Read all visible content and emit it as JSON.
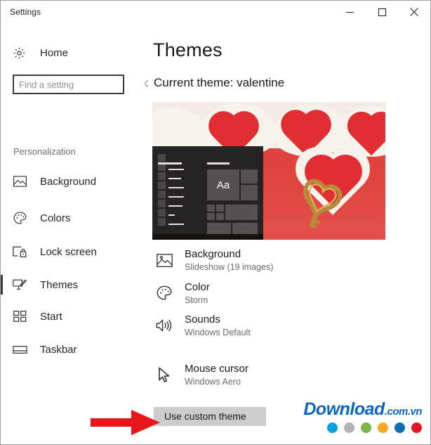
{
  "window": {
    "title": "Settings",
    "controls": [
      {
        "name": "minimize",
        "glyph": "minimize-icon"
      },
      {
        "name": "maximize",
        "glyph": "maximize-icon"
      },
      {
        "name": "close",
        "glyph": "close-icon"
      }
    ]
  },
  "sidebar": {
    "home_label": "Home",
    "home_icon": "gear-icon",
    "search": {
      "placeholder": "Find a setting",
      "value": "",
      "icon": "search-icon"
    },
    "section_label": "Personalization",
    "items": [
      {
        "label": "Background",
        "icon": "image-icon",
        "selected": false
      },
      {
        "label": "Colors",
        "icon": "palette-icon",
        "selected": false
      },
      {
        "label": "Lock screen",
        "icon": "lock-screen-icon",
        "selected": false
      },
      {
        "label": "Themes",
        "icon": "theme-brush-icon",
        "selected": true
      },
      {
        "label": "Start",
        "icon": "start-tiles-icon",
        "selected": false
      },
      {
        "label": "Taskbar",
        "icon": "taskbar-icon",
        "selected": false
      }
    ]
  },
  "main": {
    "page_title": "Themes",
    "current_theme_text": "Current theme: valentine",
    "preview": {
      "alt": "valentine-theme-preview",
      "tile_text": "Aa"
    },
    "settings": [
      {
        "title": "Background",
        "subtitle": "Slideshow (19 images)",
        "icon": "image-icon"
      },
      {
        "title": "Color",
        "subtitle": "Storm",
        "icon": "palette-icon"
      },
      {
        "title": "Sounds",
        "subtitle": "Windows Default",
        "icon": "speaker-icon"
      },
      {
        "title": "Mouse cursor",
        "subtitle": "Windows Aero",
        "icon": "cursor-icon"
      }
    ],
    "use_custom_theme_label": "Use custom theme"
  },
  "watermark": {
    "brand": "Download",
    "tld": ".com.vn",
    "brand_color": "#0a66c2",
    "dots": [
      "#00a3e0",
      "#b3b3b3",
      "#7ab648",
      "#f7a823",
      "#0b6fb4",
      "#e4152b"
    ]
  },
  "annotation": {
    "arrow_name": "red-arrow-pointing-to-use-custom-theme",
    "arrow_color": "#e8161b"
  }
}
